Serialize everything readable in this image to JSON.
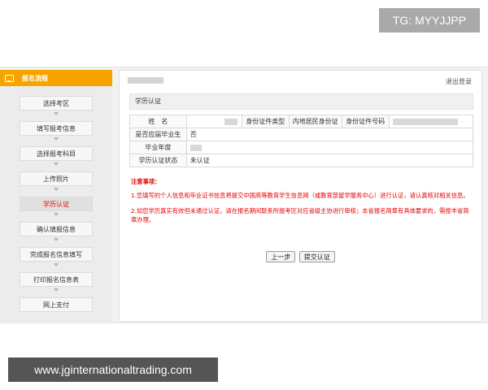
{
  "watermark": {
    "top": "TG: MYYJJPP",
    "bottom": "www.jginternationaltrading.com"
  },
  "sidebar": {
    "header": "报名流程",
    "active_index": 4,
    "items": [
      {
        "label": "选择考区"
      },
      {
        "label": "填写报考信息"
      },
      {
        "label": "选择报考科目"
      },
      {
        "label": "上传照片"
      },
      {
        "label": "学历认证"
      },
      {
        "label": "确认填报信息"
      },
      {
        "label": "完成报名信息填写"
      },
      {
        "label": "打印报名信息表"
      },
      {
        "label": "网上支付"
      }
    ]
  },
  "header": {
    "logout": "退出登录"
  },
  "section": {
    "title": "学历认证"
  },
  "info": {
    "name_label": "姓　名",
    "id_type_label": "身份证件类型",
    "id_type_value": "内地居民身份证",
    "id_number_label": "身份证件号码",
    "graduate_label": "是否应届毕业生",
    "graduate_value": "否",
    "grad_year_label": "毕业年度",
    "status_label": "学历认证状态",
    "status_value": "未认证"
  },
  "notice": {
    "heading": "注意事项：",
    "items": [
      "1.您填写的个人信息和毕业证书信息将提交中国高等教育学生信息网（或教育部留学服务中心）进行认证，请认真核对相关信息。",
      "2.如您学历真实有效但未通过认证，请在报名期间联系所报考区对应省级主协进行审核；本省报名简章有具体要求的，需按丰省简章办理。"
    ]
  },
  "actions": {
    "prev": "上一步",
    "submit": "提交认证"
  }
}
